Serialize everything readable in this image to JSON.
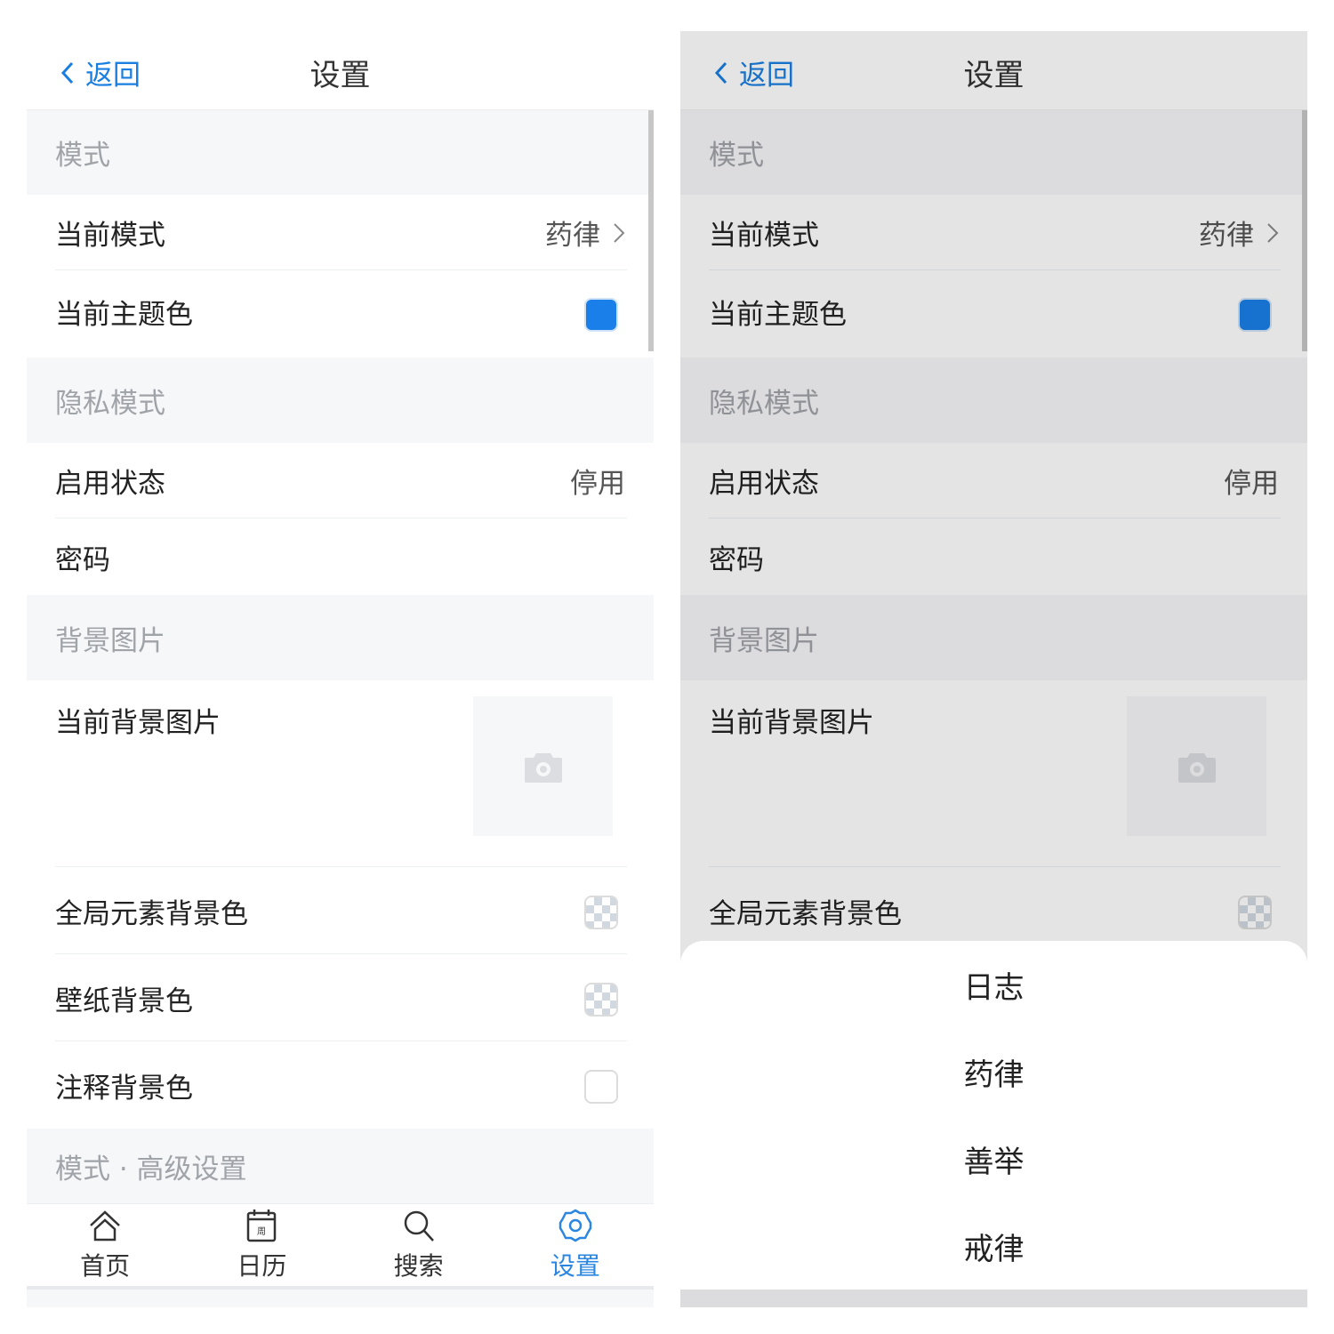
{
  "header": {
    "back_label": "返回",
    "title": "设置"
  },
  "sections": {
    "mode": "模式",
    "privacy": "隐私模式",
    "background": "背景图片",
    "advanced": "模式 · 高级设置"
  },
  "rows": {
    "current_mode": {
      "label": "当前模式",
      "value": "药律"
    },
    "theme_color": {
      "label": "当前主题色",
      "color": "#1a7fe8"
    },
    "enable_status": {
      "label": "启用状态",
      "value": "停用"
    },
    "password": {
      "label": "密码"
    },
    "current_bg_image": {
      "label": "当前背景图片"
    },
    "global_bg_color": {
      "label": "全局元素背景色"
    },
    "wallpaper_bg_color": {
      "label": "壁纸背景色"
    },
    "note_bg_color": {
      "label": "注释背景色"
    }
  },
  "tabs": [
    {
      "label": "首页",
      "icon": "home-icon"
    },
    {
      "label": "日历",
      "icon": "calendar-icon",
      "glyph": "周"
    },
    {
      "label": "搜索",
      "icon": "search-icon"
    },
    {
      "label": "设置",
      "icon": "gear-icon",
      "active": true
    }
  ],
  "action_sheet": {
    "options": [
      "日志",
      "药律",
      "善举",
      "戒律"
    ]
  },
  "colors": {
    "accent": "#1a7fe0",
    "section_bg": "#f6f7f9"
  }
}
